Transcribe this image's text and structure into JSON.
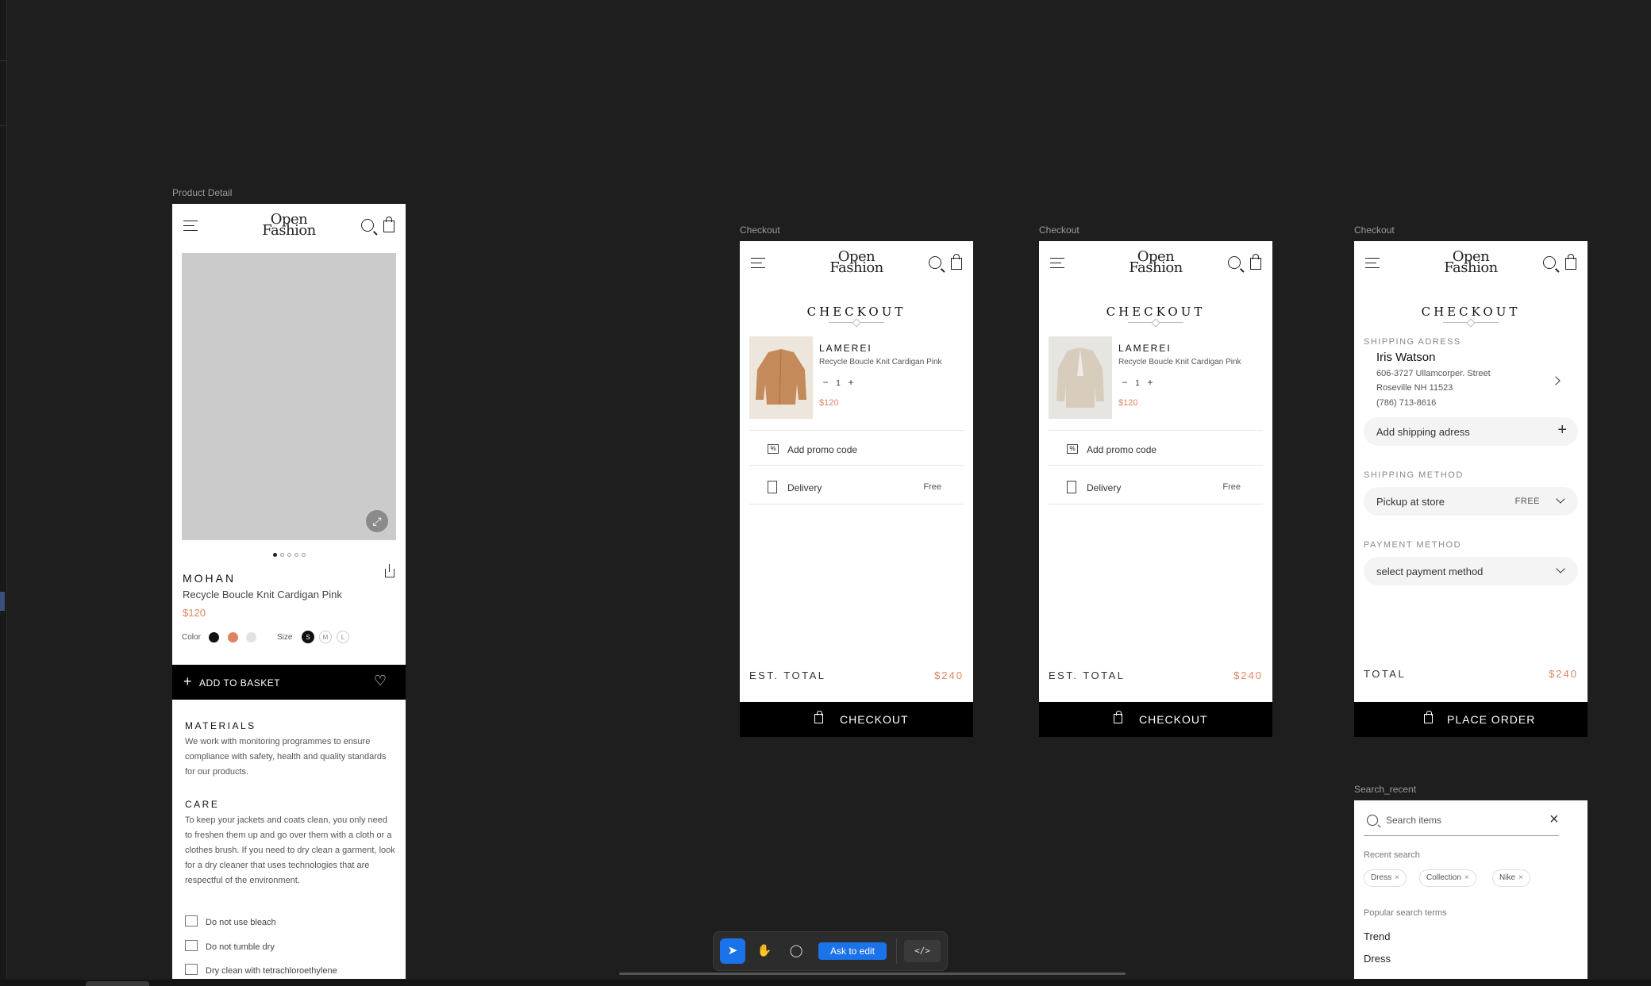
{
  "logo": {
    "line1": "Open",
    "line2": "Fashion"
  },
  "frames": {
    "product_detail": "Product Detail",
    "checkout_1": "Checkout",
    "checkout_2": "Checkout",
    "checkout_3": "Checkout",
    "search": "Search_recent"
  },
  "product": {
    "brand": "MOHAN",
    "name": "Recycle Boucle Knit Cardigan Pink",
    "price": "$120",
    "color_label": "Color",
    "colors": [
      "#111111",
      "#dd8560",
      "#e2e2e2"
    ],
    "size_label": "Size",
    "sizes": [
      "S",
      "M",
      "L"
    ],
    "add_to_basket": "ADD TO BASKET",
    "materials_title": "MATERIALS",
    "materials_text": "We work with monitoring programmes to ensure compliance with safety, health and quality standards for our products.",
    "care_title": "CARE",
    "care_text": "To keep your jackets and coats clean, you only need to freshen them up and go over them with a cloth or a clothes brush. If you need to dry clean a garment, look for a dry cleaner that uses technologies that are respectful of the environment.",
    "care_items": [
      "Do not use bleach",
      "Do not tumble dry",
      "Dry clean with tetrachloroethylene"
    ]
  },
  "checkout": {
    "title": "CHECKOUT",
    "item_brand": "LAMEREI",
    "item_name": "Recycle Boucle Knit Cardigan Pink",
    "qty": "1",
    "minus": "−",
    "plus": "+",
    "item_price": "$120",
    "promo": "Add promo code",
    "delivery": "Delivery",
    "delivery_value": "Free",
    "est_total_label": "EST. TOTAL",
    "total_value": "$240",
    "checkout_button": "CHECKOUT",
    "promo_icon": "%"
  },
  "place_order": {
    "shipping_address_label": "SHIPPING ADRESS",
    "name": "Iris Watson",
    "address_line1": "606-3727 Ullamcorper. Street",
    "address_line2": "Roseville NH 11523",
    "phone": "(786) 713-8616",
    "add_shipping": "Add shipping adress",
    "shipping_method_label": "SHIPPING METHOD",
    "shipping_method": "Pickup at store",
    "shipping_cost": "FREE",
    "payment_method_label": "PAYMENT METHOD",
    "payment_placeholder": "select payment method",
    "total_label": "TOTAL",
    "total_value": "$240",
    "place_order_button": "PLACE ORDER"
  },
  "search": {
    "placeholder": "Search items",
    "recent_label": "Recent search",
    "recent": [
      "Dress",
      "Collection",
      "Nike"
    ],
    "popular_label": "Popular search terms",
    "popular": [
      "Trend",
      "Dress"
    ],
    "clear_icon": "×",
    "chip_remove_icon": "×"
  },
  "toolbar": {
    "ask_to_edit": "Ask to edit",
    "code_label": "</>",
    "pointer_icon": "➤",
    "hand_icon": "✋",
    "comment_icon": "◯"
  }
}
